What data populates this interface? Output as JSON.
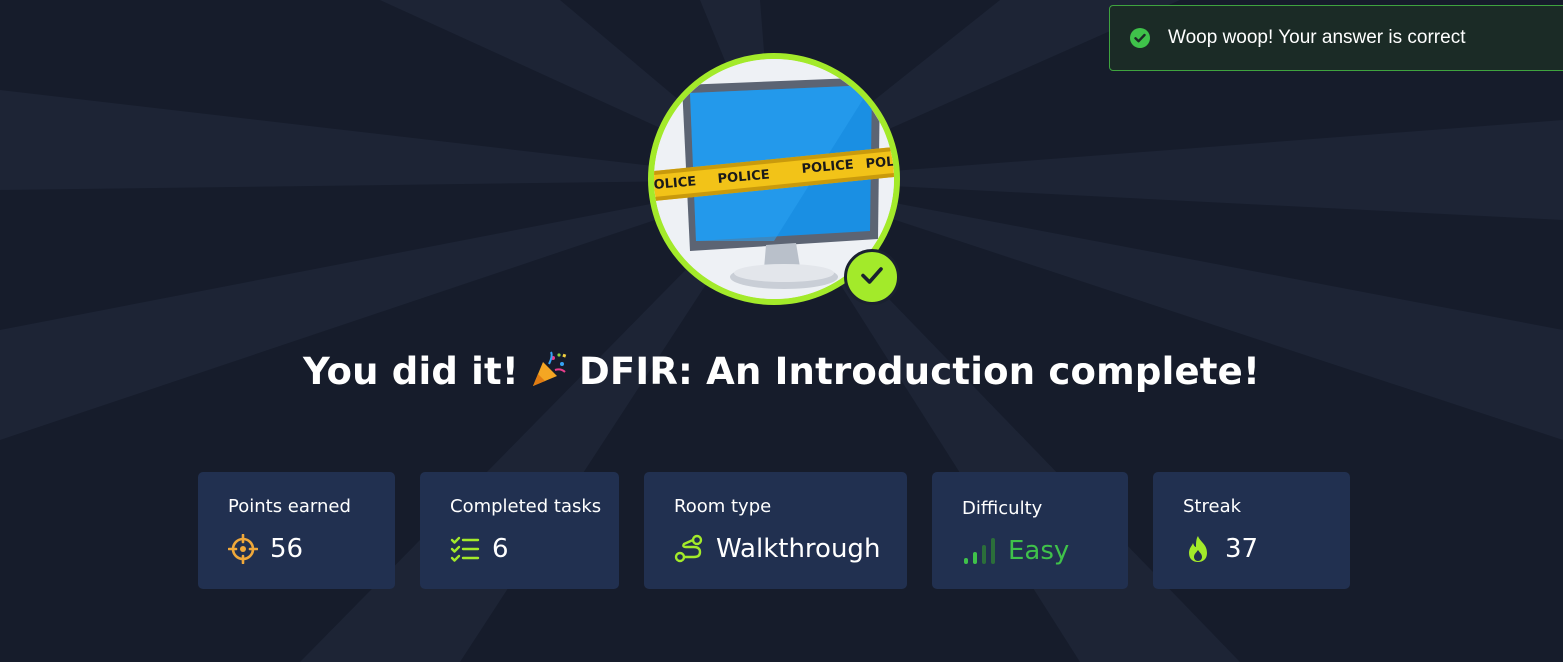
{
  "toast": {
    "message": "Woop woop! Your answer is correct",
    "icon": "check-circle-icon",
    "status_color": "#3fa33f"
  },
  "hero": {
    "image_alt": "monitor-with-police-tape",
    "tape_text": "POLICE",
    "badge_icon": "check-icon",
    "accent_color": "#a3ea2a"
  },
  "headline": {
    "prefix": "You did it!",
    "emoji_icon": "party-popper-icon",
    "room_name": "DFIR: An Introduction complete!"
  },
  "stats": {
    "points": {
      "label": "Points earned",
      "value": "56",
      "icon": "target-icon"
    },
    "tasks": {
      "label": "Completed tasks",
      "value": "6",
      "icon": "checklist-icon"
    },
    "room_type": {
      "label": "Room type",
      "value": "Walkthrough",
      "icon": "route-icon"
    },
    "difficulty": {
      "label": "Difficulty",
      "value": "Easy",
      "icon": "signal-bars-icon",
      "level_color": "#3fc24a"
    },
    "streak": {
      "label": "Streak",
      "value": "37",
      "icon": "flame-icon"
    }
  }
}
